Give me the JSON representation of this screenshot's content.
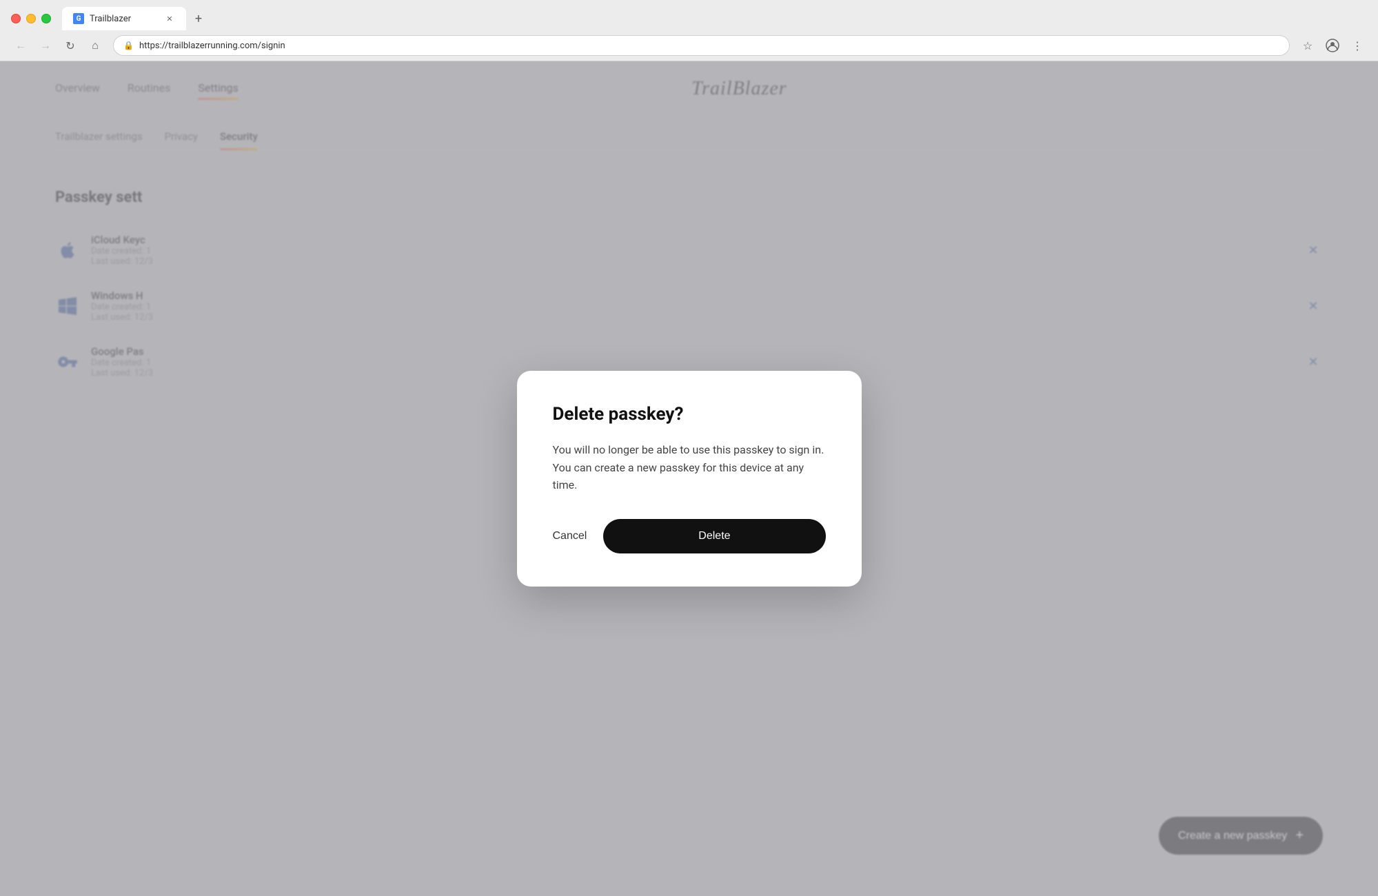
{
  "browser": {
    "tab_title": "Trailblazer",
    "url": "https://trailblazerrunning.com/signin",
    "new_tab_label": "+"
  },
  "header": {
    "logo": "TrailBlazer",
    "nav": {
      "overview": "Overview",
      "routines": "Routines",
      "settings": "Settings"
    }
  },
  "settings": {
    "tabs": {
      "trailblazer_settings": "Trailblazer settings",
      "privacy": "Privacy",
      "security": "Security"
    },
    "section_title": "Passkey sett",
    "passkeys": [
      {
        "name": "iCloud Keyc",
        "date_created": "Date created: 1",
        "last_used": "Last used: 12/3"
      },
      {
        "name": "Windows H",
        "date_created": "Date created: 1",
        "last_used": "Last used: 12/3"
      },
      {
        "name": "Google Pas",
        "date_created": "Date created: 1",
        "last_used": "Last used: 12/3"
      }
    ],
    "create_passkey_label": "Create a new passkey",
    "create_passkey_plus": "+"
  },
  "modal": {
    "title": "Delete passkey?",
    "body": "You will no longer be able to use this passkey to sign in. You can create a new passkey for this device at any time.",
    "cancel_label": "Cancel",
    "delete_label": "Delete"
  }
}
